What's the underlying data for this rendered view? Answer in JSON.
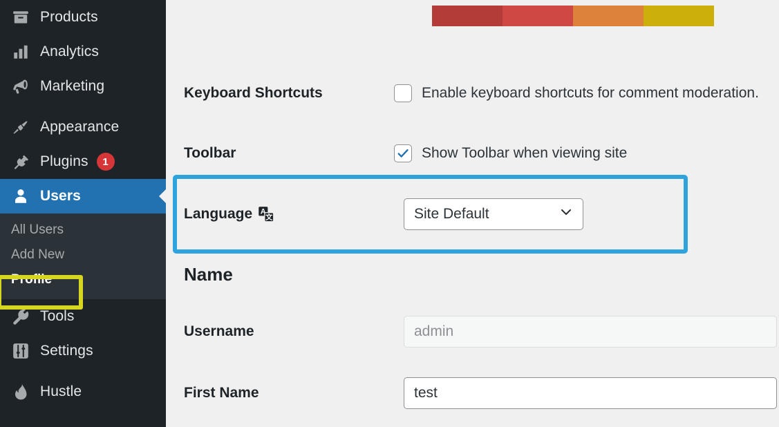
{
  "sidebar": {
    "items": [
      {
        "label": "Products",
        "icon": "products-box-icon",
        "current": false,
        "badge": null
      },
      {
        "label": "Analytics",
        "icon": "analytics-bars-icon",
        "current": false,
        "badge": null
      },
      {
        "label": "Marketing",
        "icon": "marketing-megaphone-icon",
        "current": false,
        "badge": null
      },
      {
        "label": "Appearance",
        "icon": "appearance-brush-icon",
        "current": false,
        "badge": null
      },
      {
        "label": "Plugins",
        "icon": "plugins-plug-icon",
        "current": false,
        "badge": "1"
      },
      {
        "label": "Users",
        "icon": "users-person-icon",
        "current": true,
        "badge": null
      }
    ],
    "submenu": [
      {
        "label": "All Users",
        "current": false
      },
      {
        "label": "Add New",
        "current": false
      },
      {
        "label": "Profile",
        "current": true
      }
    ],
    "items_after": [
      {
        "label": "Tools",
        "icon": "tools-wrench-icon",
        "current": false,
        "badge": null
      },
      {
        "label": "Settings",
        "icon": "settings-sliders-icon",
        "current": false,
        "badge": null
      },
      {
        "label": "Hustle",
        "icon": "hustle-flame-icon",
        "current": false,
        "badge": null
      }
    ]
  },
  "main": {
    "admin_color_scheme": {
      "name": "sunrise",
      "swatches": [
        "#b43c38",
        "#cf4944",
        "#dd823b",
        "#ccaf0b"
      ]
    },
    "rows": {
      "keyboard_shortcuts": {
        "label": "Keyboard Shortcuts",
        "checkbox_label": "Enable keyboard shortcuts for comment moderation.",
        "checked": false
      },
      "toolbar": {
        "label": "Toolbar",
        "checkbox_label": "Show Toolbar when viewing site",
        "checked": true
      },
      "language": {
        "label": "Language",
        "icon": "translate-icon",
        "selected_value": "Site Default"
      }
    },
    "name_section": {
      "heading": "Name",
      "username": {
        "label": "Username",
        "value": "admin",
        "disabled": true
      },
      "first_name": {
        "label": "First Name",
        "value": "test",
        "disabled": false
      }
    }
  },
  "annotations": {
    "language_highlight_color": "#2ea3dd",
    "profile_highlight_color": "#d6d620"
  }
}
